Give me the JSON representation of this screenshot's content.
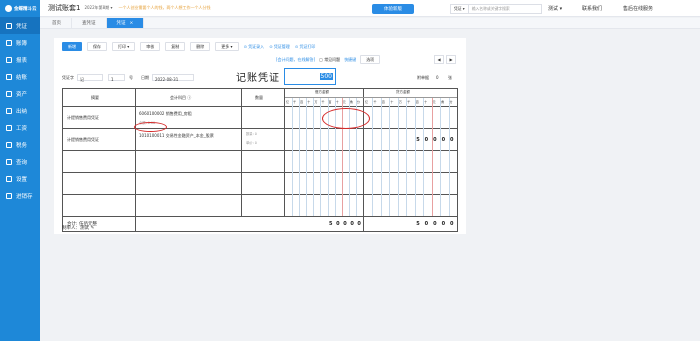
{
  "sidebar": {
    "logo": "金蝶精斗云",
    "items": [
      {
        "label": "凭证",
        "active": true
      },
      {
        "label": "账簿",
        "active": false
      },
      {
        "label": "报表",
        "active": false
      },
      {
        "label": "结账",
        "active": false
      },
      {
        "label": "资产",
        "active": false
      },
      {
        "label": "出纳",
        "active": false
      },
      {
        "label": "工资",
        "active": false
      },
      {
        "label": "税务",
        "active": false
      },
      {
        "label": "查询",
        "active": false
      },
      {
        "label": "设置",
        "active": false
      },
      {
        "label": "进销存",
        "active": false
      }
    ]
  },
  "topbar": {
    "account_title": "测试账套1",
    "period": "2022年第8期 ▾",
    "notice": "一个人创业需要个人的钱，两个人想工作一个人分钱",
    "switch_button": "体验新版",
    "search_category": "凭证 ▾",
    "search_placeholder": "输入名称或关键字搜索",
    "user": "测试 ▾",
    "contact": "联系我们",
    "service": "售后在线服务"
  },
  "tabs": [
    {
      "label": "首页",
      "active": false
    },
    {
      "label": "查凭证",
      "active": false
    },
    {
      "label": "凭证",
      "active": true
    }
  ],
  "toolbar": {
    "buttons": [
      "新增",
      "保存",
      "打印 ▾",
      "审核",
      "复制",
      "删除",
      "更多 ▾"
    ],
    "links": [
      "凭证录入",
      "凭证管理",
      "凭证打印"
    ],
    "links2": [
      "[会计问题，在线解答]",
      "常见问题",
      "快捷键"
    ],
    "settings": "选项"
  },
  "voucher": {
    "word_label": "凭证字",
    "word_value": "记",
    "number": "1",
    "number_unit": "号",
    "date_label": "日期",
    "date_value": "2022-08-31",
    "title": "记账凭证",
    "period": "2022年第8期",
    "attachments_label": "附单据",
    "attachments_value": "0",
    "attachments_unit": "张",
    "headers": {
      "summary": "摘要",
      "account": "会计科目 ⓘ",
      "quantity": "数量",
      "debit": "借方金额",
      "credit": "贷方金额"
    },
    "digit_units": [
      "亿",
      "千",
      "百",
      "十",
      "万",
      "千",
      "百",
      "十",
      "元",
      "角",
      "分"
    ],
    "rows": [
      {
        "summary": "计提销售费用凭证",
        "account": "6060100002 销售费用_房租",
        "sub_label": "余额: 0.00",
        "debit": "500",
        "credit": ""
      },
      {
        "summary": "计提销售费用凭证",
        "account": "1010100011 交易性金融资产_本金_股票",
        "qty_labels": [
          "数量: 0",
          "单价: 0"
        ],
        "debit": "",
        "credit": "50000"
      },
      {
        "summary": "",
        "account": "",
        "debit": "",
        "credit": ""
      },
      {
        "summary": "",
        "account": "",
        "debit": "",
        "credit": ""
      }
    ],
    "total_label": "合计: 伍佰元整",
    "total_debit": "50000",
    "total_credit": "50000",
    "editor_label": "制单人：",
    "editor_value": "测试"
  }
}
